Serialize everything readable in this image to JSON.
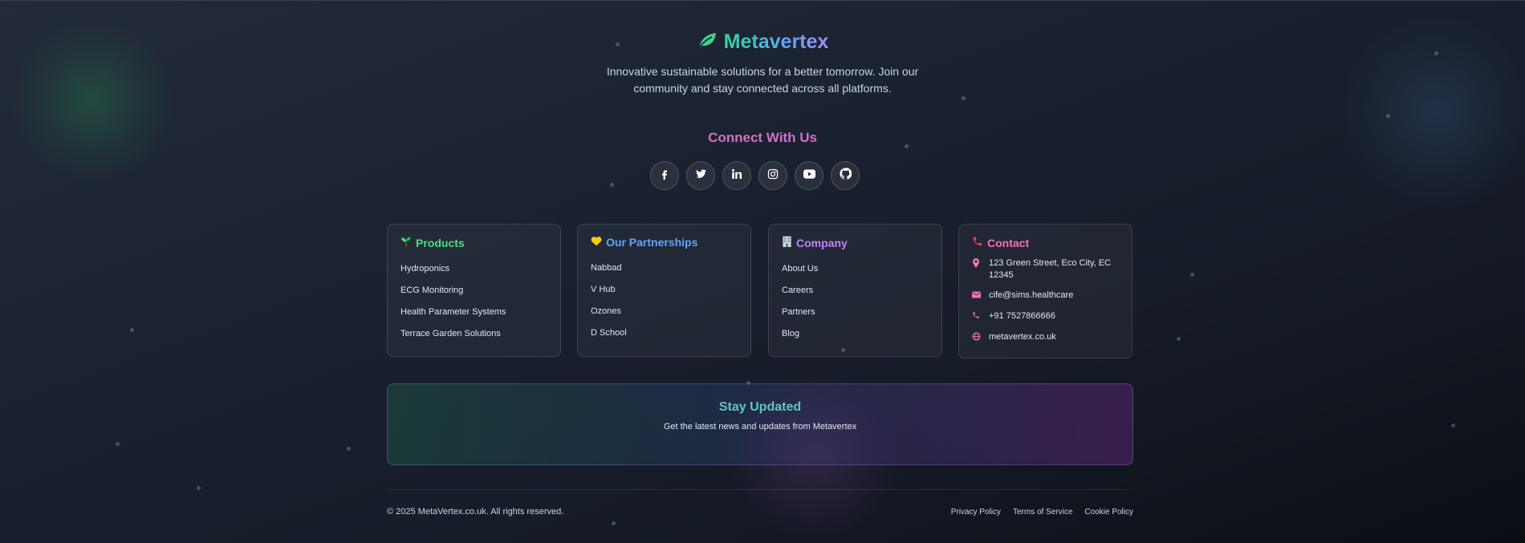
{
  "brand": {
    "name": "Metavertex",
    "tagline": "Innovative sustainable solutions for a better tomorrow. Join our community and stay connected across all platforms."
  },
  "connect": {
    "title": "Connect With Us",
    "socials": [
      "facebook-icon",
      "twitter-icon",
      "linkedin-icon",
      "instagram-icon",
      "youtube-icon",
      "github-icon"
    ]
  },
  "products": {
    "title": "Products",
    "icon": "seedling-icon",
    "accent": "#4ade80",
    "items": [
      "Hydroponics",
      "ECG Monitoring",
      "Health Parameter Systems",
      "Terrace Garden Solutions"
    ]
  },
  "partnerships": {
    "title": "Our Partnerships",
    "icon": "yellow-heart-icon",
    "accent": "#60a5fa",
    "items": [
      "Nabbad",
      "V Hub",
      "Ozones",
      "D School"
    ]
  },
  "company": {
    "title": "Company",
    "icon": "building-icon",
    "accent": "#c084fc",
    "items": [
      "About Us",
      "Careers",
      "Partners",
      "Blog"
    ]
  },
  "contact": {
    "title": "Contact",
    "icon": "phone-icon",
    "accent": "#f472b6",
    "address": "123 Green Street, Eco City, EC 12345",
    "email": "cife@sims.healthcare",
    "phone": "+91 7527866666",
    "website": "metavertex.co.uk"
  },
  "newsletter": {
    "title": "Stay Updated",
    "subtitle": "Get the latest news and updates from Metavertex"
  },
  "footer": {
    "copyright": "© 2025 MetaVertex.co.uk. All rights reserved.",
    "links": [
      "Privacy Policy",
      "Terms of Service",
      "Cookie Policy"
    ]
  }
}
